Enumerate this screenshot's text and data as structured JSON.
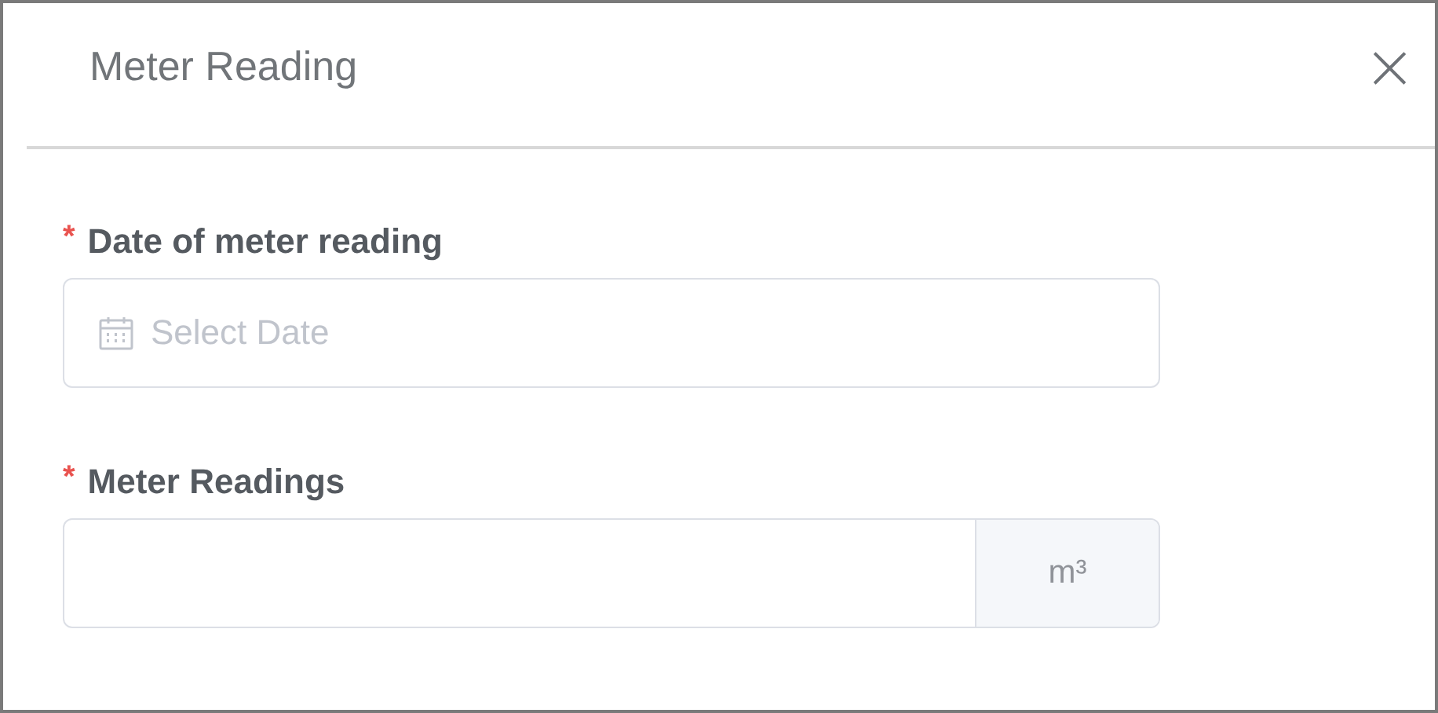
{
  "dialog": {
    "title": "Meter Reading",
    "close_icon": "×"
  },
  "fields": [
    {
      "kind": "date",
      "required_mark": "*",
      "label": "Date of meter reading",
      "placeholder": "Select Date"
    },
    {
      "kind": "unit",
      "required_mark": "*",
      "label": "Meter Readings",
      "unit": "m³"
    }
  ]
}
